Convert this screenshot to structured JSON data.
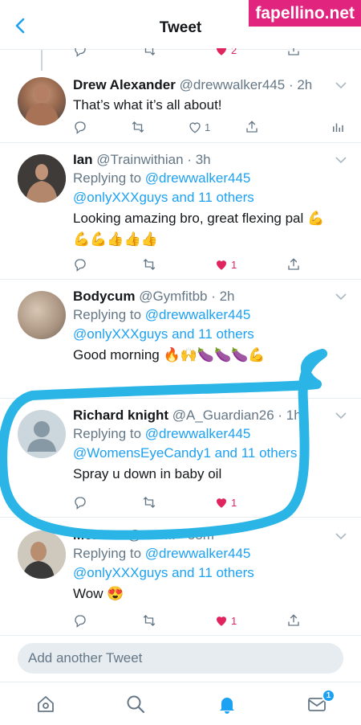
{
  "header": {
    "title": "Tweet",
    "watermark": "fapellino.net"
  },
  "top_actions": {
    "like_count": "2"
  },
  "tweets": [
    {
      "name": "Drew Alexander",
      "handle": "@drewwalker445",
      "time": "· 2h",
      "text": "That’s what it’s all about!",
      "like_count": "1"
    },
    {
      "name": "Ian",
      "handle": "@Trainwithian",
      "time": "· 3h",
      "replying_prefix": "Replying to",
      "replying_to": "@drewwalker445",
      "replying_others": "@onlyXXXguys and 11 others",
      "text": "Looking amazing bro, great flexing pal 💪",
      "text2": "💪💪👍👍👍",
      "like_count": "1"
    },
    {
      "name": "Bodycum",
      "handle": "@Gymfitbb",
      "time": "· 2h",
      "replying_prefix": "Replying to",
      "replying_to": "@drewwalker445",
      "replying_others": "@onlyXXXguys and 11 others",
      "text": "Good morning 🔥🙌🍆🍆🍆💪"
    },
    {
      "name": "Richard knight",
      "handle": "@A_Guardian26",
      "time": "· 1h",
      "replying_prefix": "Replying to",
      "replying_to": "@drewwalker445",
      "replying_others": "@WomensEyeCandy1 and 11 others",
      "text": "Spray u down in baby oil",
      "like_count": "1"
    },
    {
      "name": "Mozartz",
      "handle": "@Mar...",
      "time": "· 55m",
      "replying_prefix": "Replying to",
      "replying_to": "@drewwalker445",
      "replying_others": "@onlyXXXguys and 11 others",
      "text": "Wow 😍",
      "like_count": "1"
    }
  ],
  "composer": {
    "placeholder": "Add another Tweet"
  },
  "tabbar": {
    "messages_badge": "1"
  },
  "colors": {
    "accent": "#1da1f2",
    "like": "#e0245e",
    "annotation": "#2ab5e6"
  }
}
